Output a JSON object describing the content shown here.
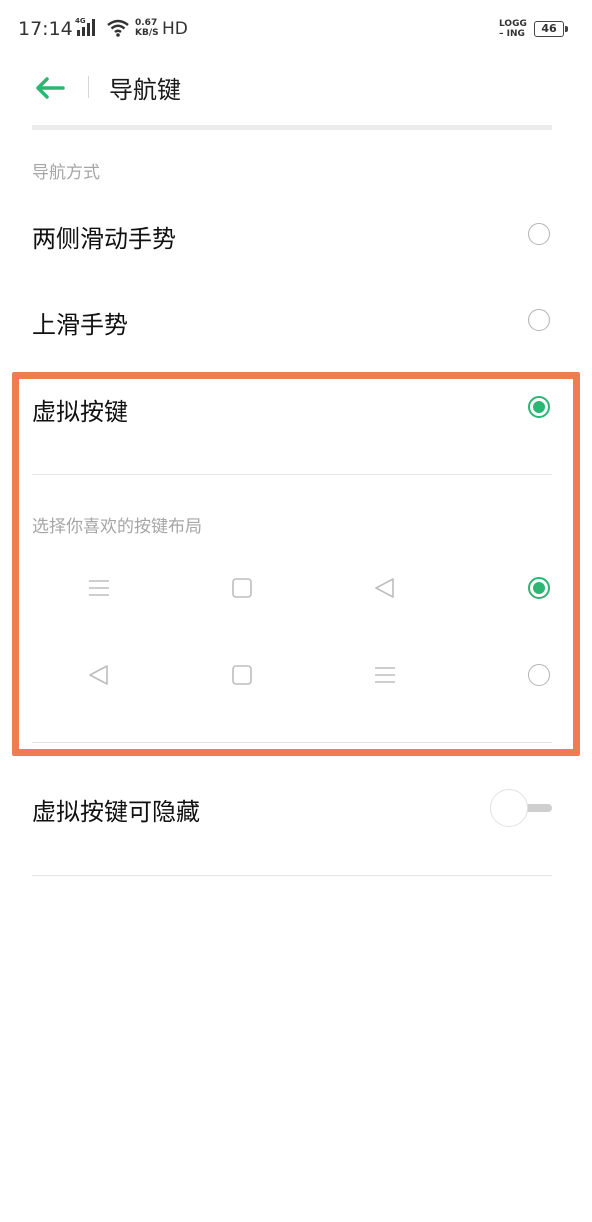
{
  "status": {
    "time": "17:14",
    "network_type": "4G",
    "speed_value": "0.67",
    "speed_unit": "KB/S",
    "hd": "HD",
    "logging_line1": "LOGG",
    "logging_line2": "– ING",
    "battery": "46"
  },
  "header": {
    "title": "导航键",
    "back_icon": "arrow-left-icon"
  },
  "section": {
    "label": "导航方式"
  },
  "options": [
    {
      "label": "两侧滑动手势",
      "selected": false
    },
    {
      "label": "上滑手势",
      "selected": false
    },
    {
      "label": "虚拟按键",
      "selected": true
    }
  ],
  "layout_section": {
    "label": "选择你喜欢的按键布局"
  },
  "layouts": [
    {
      "keys": [
        "menu-icon",
        "home-square-icon",
        "back-triangle-icon"
      ],
      "selected": true
    },
    {
      "keys": [
        "back-triangle-icon",
        "home-square-icon",
        "menu-icon"
      ],
      "selected": false
    }
  ],
  "hide_keys": {
    "label": "虚拟按键可隐藏",
    "enabled": false
  },
  "colors": {
    "accent": "#2bb673",
    "highlight": "#ef7c52"
  }
}
